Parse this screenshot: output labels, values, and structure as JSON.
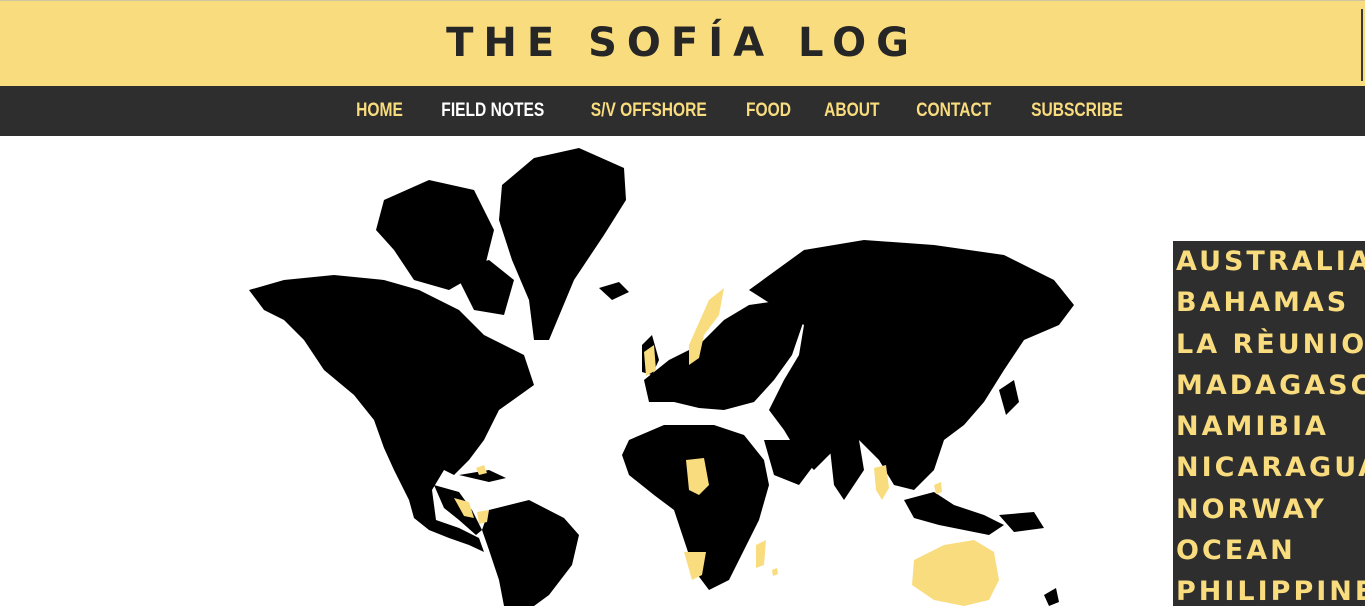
{
  "site": {
    "title": "THE SOFÍA LOG"
  },
  "nav": {
    "items": [
      {
        "label": "HOME"
      },
      {
        "label": "FIELD NOTES"
      },
      {
        "label": "S/V OFFSHORE"
      },
      {
        "label": "FOOD"
      },
      {
        "label": "ABOUT"
      },
      {
        "label": "CONTACT"
      },
      {
        "label": "SUBSCRIBE"
      }
    ],
    "active": "FIELD NOTES"
  },
  "map": {
    "land_color": "#000000",
    "visited_color": "#f9dc7e"
  },
  "countries": {
    "items": [
      {
        "label": "AUSTRALIA"
      },
      {
        "label": "BAHAMAS"
      },
      {
        "label": "LA RÈUNION"
      },
      {
        "label": "MADAGASCAR"
      },
      {
        "label": "NAMIBIA"
      },
      {
        "label": "NICARAGUA"
      },
      {
        "label": "NORWAY"
      },
      {
        "label": "OCEAN"
      },
      {
        "label": "PHILIPPINES"
      }
    ]
  },
  "colors": {
    "accent": "#f9dc7e",
    "dark": "#2e2e2e"
  }
}
